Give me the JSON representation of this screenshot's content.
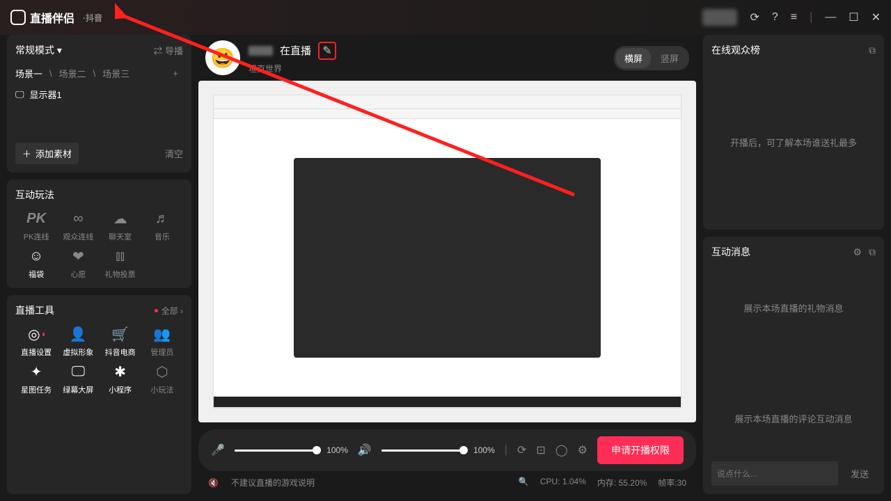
{
  "titlebar": {
    "app_name": "直播伴侣",
    "sub": "·抖音"
  },
  "sidebar": {
    "mode": "常规模式 ▾",
    "guide": "导播",
    "scenes": [
      "场景一",
      "场景二",
      "场景三"
    ],
    "source_monitor": "显示器1",
    "add_source": "添加素材",
    "clear": "清空",
    "interactive_title": "互动玩法",
    "interactive": [
      {
        "label": "PK连线",
        "icon": "PK"
      },
      {
        "label": "观众连线",
        "icon": "∞"
      },
      {
        "label": "聊天室",
        "icon": "☁"
      },
      {
        "label": "音乐",
        "icon": "♬"
      },
      {
        "label": "福袋",
        "icon": "☺"
      },
      {
        "label": "心愿",
        "icon": "❤"
      },
      {
        "label": "礼物投票",
        "icon": "⫾⫾"
      }
    ],
    "tools_title": "直播工具",
    "all_label": "全部 ›",
    "tools": [
      {
        "label": "直播设置",
        "icon": "◎"
      },
      {
        "label": "虚拟形象",
        "icon": "👤"
      },
      {
        "label": "抖音电商",
        "icon": "🛒"
      },
      {
        "label": "管理员",
        "icon": "👥"
      },
      {
        "label": "星图任务",
        "icon": "✦"
      },
      {
        "label": "绿幕大屏",
        "icon": "🖵"
      },
      {
        "label": "小程序",
        "icon": "✱"
      },
      {
        "label": "小玩法",
        "icon": "⬡"
      }
    ]
  },
  "stream": {
    "title_suffix": "在直播",
    "category": "坦克世界",
    "orientation": {
      "horizontal": "横屏",
      "vertical": "竖屏"
    }
  },
  "controls": {
    "mic_pct": "100%",
    "spk_pct": "100%",
    "go_live": "申请开播权限"
  },
  "status": {
    "warn": "不建议直播的游戏说明",
    "cpu_label": "CPU:",
    "cpu": "1.04%",
    "mem_label": "内存:",
    "mem": "55.20%",
    "fps_label": "帧率:",
    "fps": "30"
  },
  "right": {
    "viewers_title": "在线观众榜",
    "viewers_hint": "开播后，可了解本场谁送礼最多",
    "msgs_title": "互动消息",
    "msg_hint1": "展示本场直播的礼物消息",
    "msg_hint2": "展示本场直播的评论互动消息",
    "chat_placeholder": "说点什么...",
    "send": "发送"
  }
}
